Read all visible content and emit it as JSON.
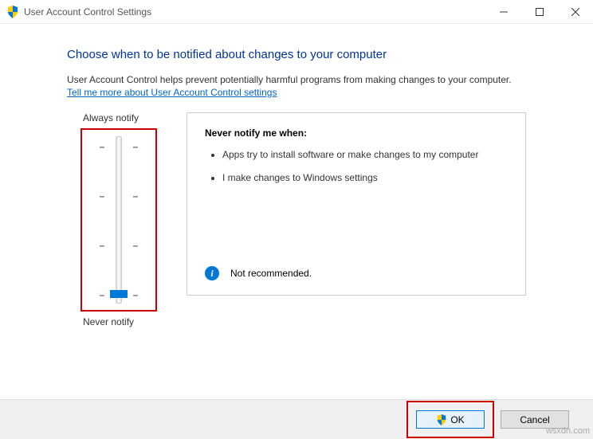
{
  "titlebar": {
    "title": "User Account Control Settings"
  },
  "heading": "Choose when to be notified about changes to your computer",
  "description": "User Account Control helps prevent potentially harmful programs from making changes to your computer.",
  "link_text": "Tell me more about User Account Control settings",
  "slider": {
    "top_label": "Always notify",
    "bottom_label": "Never notify",
    "levels": 4,
    "current_level": 0
  },
  "panel": {
    "title": "Never notify me when:",
    "bullets": [
      "Apps try to install software or make changes to my computer",
      "I make changes to Windows settings"
    ],
    "footer_text": "Not recommended."
  },
  "buttons": {
    "ok": "OK",
    "cancel": "Cancel"
  },
  "watermark": "wsxdn.com"
}
